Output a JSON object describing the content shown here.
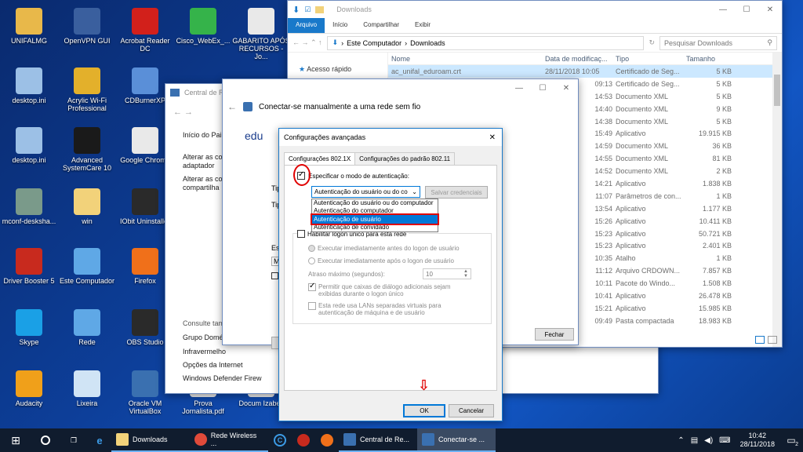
{
  "colors": {
    "accent": "#0078d7",
    "selection": "#cce8ff",
    "highlight_red": "#e00000",
    "taskbar": "#101c2e"
  },
  "desktop_icons": [
    {
      "label": "UNIFALMG",
      "icon": "user-folder-icon",
      "color": "#e8b84a"
    },
    {
      "label": "OpenVPN GUI",
      "icon": "openvpn-icon",
      "color": "#3a5f9e"
    },
    {
      "label": "Acrobat Reader DC",
      "icon": "acrobat-icon",
      "color": "#d2201b"
    },
    {
      "label": "Cisco_WebEx_...",
      "icon": "webex-icon",
      "color": "#35b34a"
    },
    {
      "label": "GABARITO APÓS RECURSOS - Jo...",
      "icon": "pdf-file-icon",
      "color": "#e9e9e9"
    },
    {
      "label": "desktop.ini",
      "icon": "settings-file-icon",
      "color": "#9cc0e6"
    },
    {
      "label": "Acrylic Wi-Fi Professional",
      "icon": "acrylic-wifi-icon",
      "color": "#e3b02b"
    },
    {
      "label": "CDBurnerXP",
      "icon": "cdburner-icon",
      "color": "#5a8fd8"
    },
    {
      "label": "desktop.ini",
      "icon": "settings-file-icon",
      "color": "#9cc0e6"
    },
    {
      "label": "Advanced SystemCare 10",
      "icon": "systemcare-icon",
      "color": "#1a1a1a"
    },
    {
      "label": "Google Chrome",
      "icon": "chrome-icon",
      "color": "#e9e9e9"
    },
    {
      "label": "mconf-desksha...",
      "icon": "mconf-icon",
      "color": "#7a9a8a"
    },
    {
      "label": "win",
      "icon": "folder-icon",
      "color": "#f2d27a"
    },
    {
      "label": "IObit Uninstaller",
      "icon": "iobit-icon",
      "color": "#2a2a2a"
    },
    {
      "label": "Driver Booster 5",
      "icon": "driver-booster-icon",
      "color": "#c82a1e"
    },
    {
      "label": "Este Computador",
      "icon": "computer-icon",
      "color": "#5fa8e6"
    },
    {
      "label": "Firefox",
      "icon": "firefox-icon",
      "color": "#f0701a"
    },
    {
      "label": "Skype",
      "icon": "skype-icon",
      "color": "#1aa0e6"
    },
    {
      "label": "Rede",
      "icon": "network-icon",
      "color": "#5fa8e6"
    },
    {
      "label": "OBS Studio",
      "icon": "obs-icon",
      "color": "#2a2a2a"
    },
    {
      "label": "Audacity",
      "icon": "audacity-icon",
      "color": "#f0a01a"
    },
    {
      "label": "Lixeira",
      "icon": "recycle-bin-icon",
      "color": "#d0e4f5"
    },
    {
      "label": "Oracle VM VirtualBox",
      "icon": "virtualbox-icon",
      "color": "#3a70b0"
    },
    {
      "label": "Prova Jornalista.pdf",
      "icon": "pdf-file-icon",
      "color": "#e9e9e9"
    },
    {
      "label": "Docum Izabell",
      "icon": "document-icon",
      "color": "#e9e9e9"
    }
  ],
  "explorer": {
    "title": "Downloads",
    "ribbon_tabs": [
      "Arquivo",
      "Início",
      "Compartilhar",
      "Exibir"
    ],
    "path": [
      "Este Computador",
      "Downloads"
    ],
    "search_placeholder": "Pesquisar Downloads",
    "nav_quick_access": "Acesso rápido",
    "columns": [
      "Nome",
      "Data de modificaç...",
      "Tipo",
      "Tamanho"
    ],
    "files": [
      {
        "name": "ac_unifal_eduroam.crt",
        "date": "28/11/2018 10:05",
        "type": "Certificado de Seg...",
        "size": "5 KB"
      },
      {
        "name": "",
        "date": "09:13",
        "type": "Certificado de Seg...",
        "size": "5 KB"
      },
      {
        "name": "",
        "date": "14:53",
        "type": "Documento XML",
        "size": "5 KB"
      },
      {
        "name": "",
        "date": "14:40",
        "type": "Documento XML",
        "size": "9 KB"
      },
      {
        "name": "",
        "date": "14:38",
        "type": "Documento XML",
        "size": "5 KB"
      },
      {
        "name": "",
        "date": "15:49",
        "type": "Aplicativo",
        "size": "19.915 KB"
      },
      {
        "name": "",
        "date": "14:59",
        "type": "Documento XML",
        "size": "36 KB"
      },
      {
        "name": "",
        "date": "14:55",
        "type": "Documento XML",
        "size": "81 KB"
      },
      {
        "name": "",
        "date": "14:52",
        "type": "Documento XML",
        "size": "2 KB"
      },
      {
        "name": "",
        "date": "14:21",
        "type": "Aplicativo",
        "size": "1.838 KB"
      },
      {
        "name": "",
        "date": "11:07",
        "type": "Parâmetros de con...",
        "size": "1 KB"
      },
      {
        "name": "",
        "date": "13:54",
        "type": "Aplicativo",
        "size": "1.177 KB"
      },
      {
        "name": "",
        "date": "15:26",
        "type": "Aplicativo",
        "size": "10.411 KB"
      },
      {
        "name": "",
        "date": "15:23",
        "type": "Aplicativo",
        "size": "50.721 KB"
      },
      {
        "name": "",
        "date": "15:23",
        "type": "Aplicativo",
        "size": "2.401 KB"
      },
      {
        "name": "",
        "date": "10:35",
        "type": "Atalho",
        "size": "1 KB"
      },
      {
        "name": "",
        "date": "11:12",
        "type": "Arquivo CRDOWN...",
        "size": "7.857 KB"
      },
      {
        "name": "",
        "date": "10:11",
        "type": "Pacote do Windo...",
        "size": "1.508 KB"
      },
      {
        "name": "",
        "date": "10:41",
        "type": "Aplicativo",
        "size": "26.478 KB"
      },
      {
        "name": "",
        "date": "15:21",
        "type": "Aplicativo",
        "size": "15.985 KB"
      },
      {
        "name": "",
        "date": "09:49",
        "type": "Pasta compactada",
        "size": "18.983 KB"
      }
    ]
  },
  "central": {
    "title": "Central de Rede",
    "links": [
      "Início do Pai",
      "Alterar as co adaptador",
      "Alterar as co compartilha"
    ],
    "see_also": "Consulte tam",
    "see_also_links": [
      "Grupo Domé",
      "Infravermelho",
      "Opções da Internet",
      "Windows Defender Firew"
    ]
  },
  "conectar": {
    "title": "Conectar-se manualmente a uma rede sem fio",
    "heading_fragment": "edu",
    "left_fragments": [
      "Tip",
      "Tip",
      "Es",
      "M"
    ],
    "close_label": "Fechar"
  },
  "advanced": {
    "title": "Configurações avançadas",
    "tabs": [
      "Configurações 802.1X",
      "Configurações do padrão 802.11"
    ],
    "specify_label": "Especificar o modo de autenticação:",
    "auth_selected": "Autenticação do usuário ou do co",
    "save_credentials": "Salvar credenciais",
    "dropdown_options": [
      "Autenticação do usuário ou do computador",
      "Autenticação do computador",
      "Autenticação de usuário",
      "Autenticação de convidado"
    ],
    "sso_label": "Habilitar logon único para esta rede",
    "radio1": "Executar imediatamente antes do logon de usuário",
    "radio2": "Executar imediatamente após o logon de usuário",
    "delay_label": "Atraso máximo (segundos):",
    "delay_value": "10",
    "allow_dialogs": "Permitir que caixas de diálogo adicionais sejam exibidas durante o logon único",
    "vlan_label": "Esta rede usa LANs separadas virtuais para autenticação de máquina e de usuário",
    "ok": "OK",
    "cancel": "Cancelar"
  },
  "taskbar": {
    "items": [
      {
        "label": "Downloads",
        "icon": "folder-icon"
      },
      {
        "label": "Rede Wireless ...",
        "icon": "chrome-icon"
      },
      {
        "label": "Central de Re...",
        "icon": "network-center-icon"
      },
      {
        "label": "Conectar-se ...",
        "icon": "network-connect-icon"
      }
    ],
    "time": "10:42",
    "date": "28/11/2018",
    "notifications": "2"
  }
}
